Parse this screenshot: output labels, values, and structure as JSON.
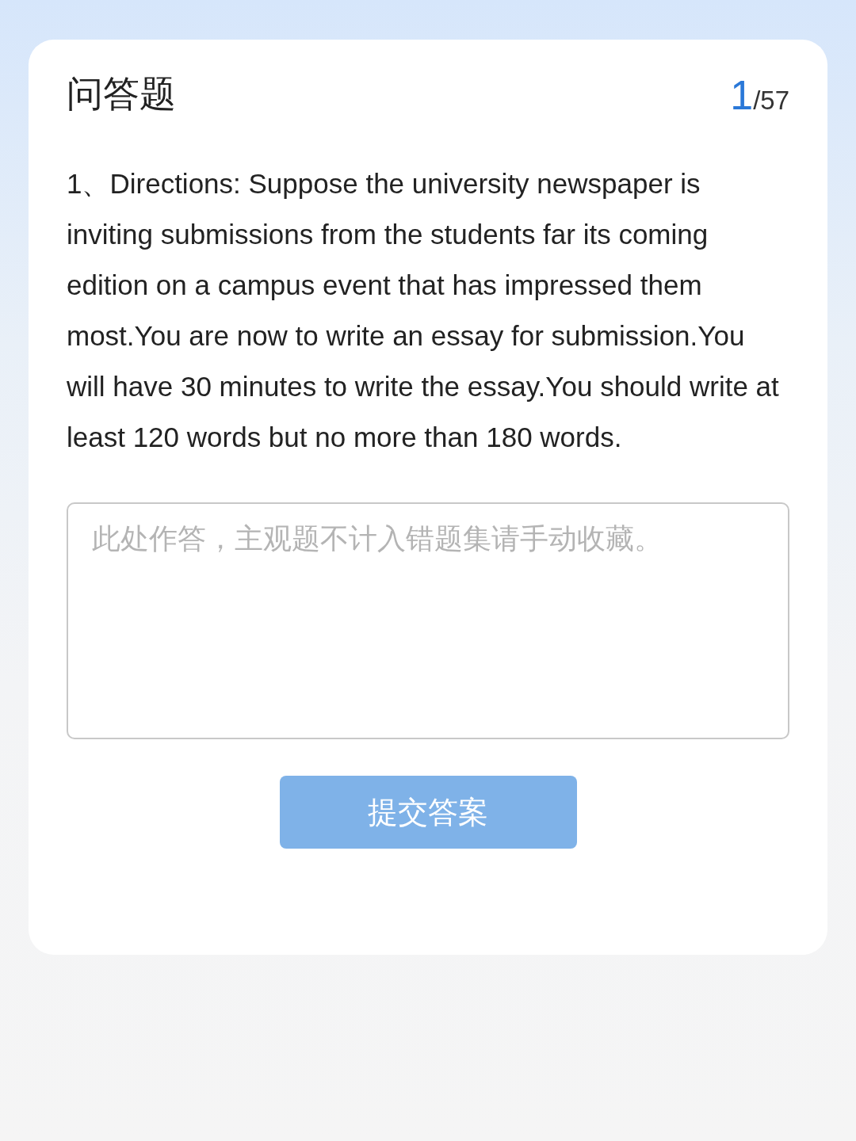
{
  "card": {
    "title": "问答题",
    "counter": {
      "current": "1",
      "total": "/57"
    },
    "question": "1、Directions: Suppose the university newspaper is inviting submissions from the students far its coming edition on a campus event that has impressed them most.You are now to write an essay for submission.You will have 30 minutes to write the essay.You should write at least 120 words but no more than 180 words.",
    "answer": {
      "placeholder": "此处作答，主观题不计入错题集请手动收藏。"
    },
    "submit": {
      "label": "提交答案",
      "disabled": true
    }
  }
}
